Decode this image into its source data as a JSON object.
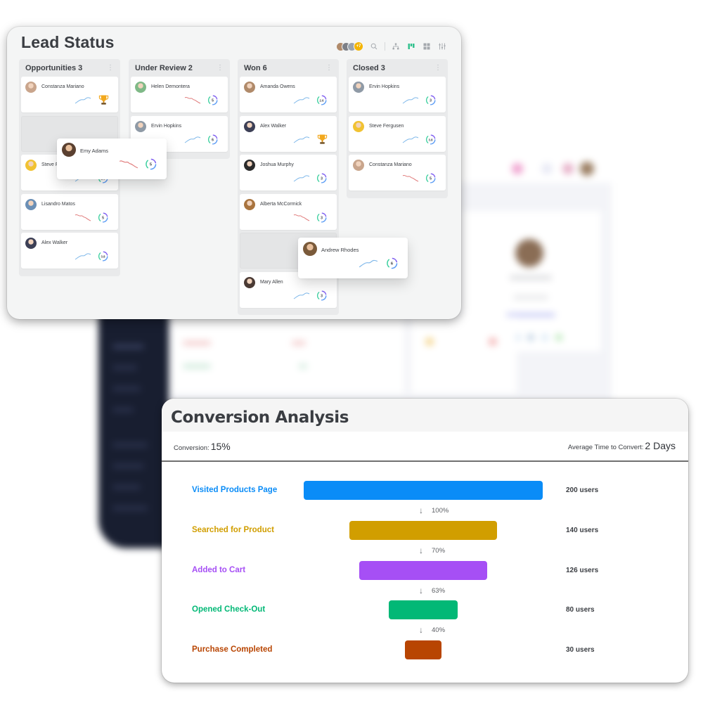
{
  "lead_status": {
    "title": "Lead Status",
    "toolbar": {
      "more_count": "+7",
      "icons": [
        "search-icon",
        "hierarchy-icon",
        "kanban-view-icon",
        "grid-view-icon",
        "filter-settings-icon"
      ],
      "active_color": "#2bbf8a"
    },
    "columns": [
      {
        "title": "Opportunities 3",
        "cards": [
          {
            "name": "Constanza Mariano",
            "trend": "up",
            "badge": "trophy",
            "avatar_color": "#c9a58c"
          },
          {
            "placeholder": true
          },
          {
            "name": "Steve Fergusen",
            "trend": "up",
            "score": "2.6",
            "avatar_color": "#f1c232"
          },
          {
            "name": "Lisandro Matos",
            "trend": "down",
            "score": "5",
            "avatar_color": "#6b8fb5"
          },
          {
            "name": "Alex Walker",
            "trend": "up",
            "score": "3.8",
            "avatar_color": "#3c3f55"
          }
        ]
      },
      {
        "title": "Under Review 2",
        "cards": [
          {
            "name": "Helen Demontera",
            "trend": "down",
            "score": "5",
            "avatar_color": "#7fb987"
          },
          {
            "name": "Ervin Hopkins",
            "trend": "up",
            "score": "6",
            "avatar_color": "#8f9aa6"
          }
        ]
      },
      {
        "title": "Won 6",
        "cards": [
          {
            "name": "Amanda Owens",
            "trend": "up",
            "score": "2.6",
            "avatar_color": "#b08a6a"
          },
          {
            "name": "Alex Walker",
            "trend": "up",
            "badge": "trophy",
            "avatar_color": "#3c3f55"
          },
          {
            "name": "Joshua Murphy",
            "trend": "up",
            "score": "3",
            "avatar_color": "#2b2b2b"
          },
          {
            "name": "Alberta McCormick",
            "trend": "down",
            "score": "3",
            "avatar_color": "#a9743e"
          },
          {
            "placeholder": true
          },
          {
            "name": "Mary Allen",
            "trend": "up",
            "score": "3",
            "avatar_color": "#4a3a34"
          }
        ]
      },
      {
        "title": "Closed 3",
        "cards": [
          {
            "name": "Ervin Hopkins",
            "trend": "up",
            "score": "3",
            "avatar_color": "#8f9aa6"
          },
          {
            "name": "Steve Fergusen",
            "trend": "up",
            "score": "3.8",
            "avatar_color": "#f1c232"
          },
          {
            "name": "Constanza Mariano",
            "trend": "down",
            "score": "5",
            "avatar_color": "#c9a58c"
          }
        ]
      }
    ],
    "dragging_cards": [
      {
        "name": "Emy Adams",
        "trend": "down",
        "score": "5",
        "avatar_color": "#5a4030"
      },
      {
        "name": "Andrew Rhodes",
        "trend": "up",
        "score": "6",
        "avatar_color": "#7a5a3a"
      }
    ],
    "colors": {
      "trend_up": "#7fb8ea",
      "trend_down": "#e07a7a",
      "ring_green": "#3ed0a0",
      "ring_blue": "#5b9cf5",
      "ring_purple": "#7d5cf0",
      "trophy": "#f2a81d"
    }
  },
  "conversion": {
    "title": "Conversion Analysis",
    "conversion_label": "Conversion:",
    "conversion_value": "15%",
    "avg_time_label": "Average Time to Convert:",
    "avg_time_value": "2 Days"
  },
  "chart_data": {
    "type": "bar",
    "title": "Conversion Analysis",
    "orientation": "horizontal-funnel",
    "categories": [
      "Visited Products Page",
      "Searched for Product",
      "Added to Cart",
      "Opened Check-Out",
      "Purchase Completed"
    ],
    "values": [
      200,
      140,
      126,
      80,
      30
    ],
    "value_labels": [
      "200 users",
      "140 users",
      "126 users",
      "80 users",
      "30 users"
    ],
    "step_rates": [
      "100%",
      "70%",
      "63%",
      "40%"
    ],
    "colors": [
      "#0a8cf7",
      "#d19e00",
      "#a64ff5",
      "#02b876",
      "#b84502"
    ],
    "xlabel": "",
    "ylabel": "",
    "xlim": [
      0,
      200
    ]
  }
}
